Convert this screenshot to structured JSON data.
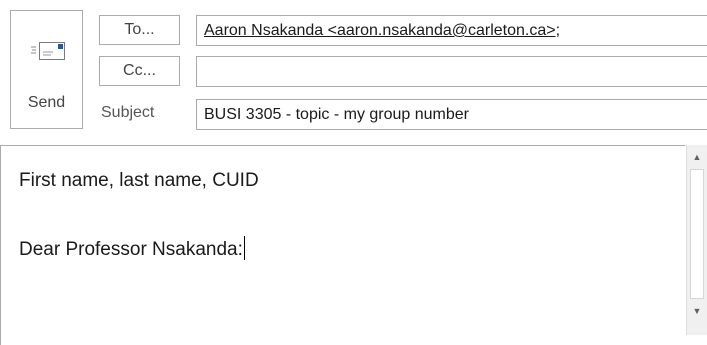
{
  "compose": {
    "send_label": "Send",
    "to_button_label": "To...",
    "cc_button_label": "Cc...",
    "subject_label": "Subject",
    "to_value": "Aaron Nsakanda <aaron.nsakanda@carleton.ca>;",
    "cc_value": "",
    "subject_value": "BUSI 3305 - topic - my group number"
  },
  "body": {
    "line1": "First name, last name, CUID",
    "line2": "Dear Professor Nsakanda:"
  },
  "icons": {
    "send": "send-envelope-icon",
    "scroll_up": "scroll-up-arrow-icon",
    "scroll_down": "scroll-down-arrow-icon"
  },
  "colors": {
    "border": "#ababab",
    "send_icon_accent": "#2b579a"
  }
}
